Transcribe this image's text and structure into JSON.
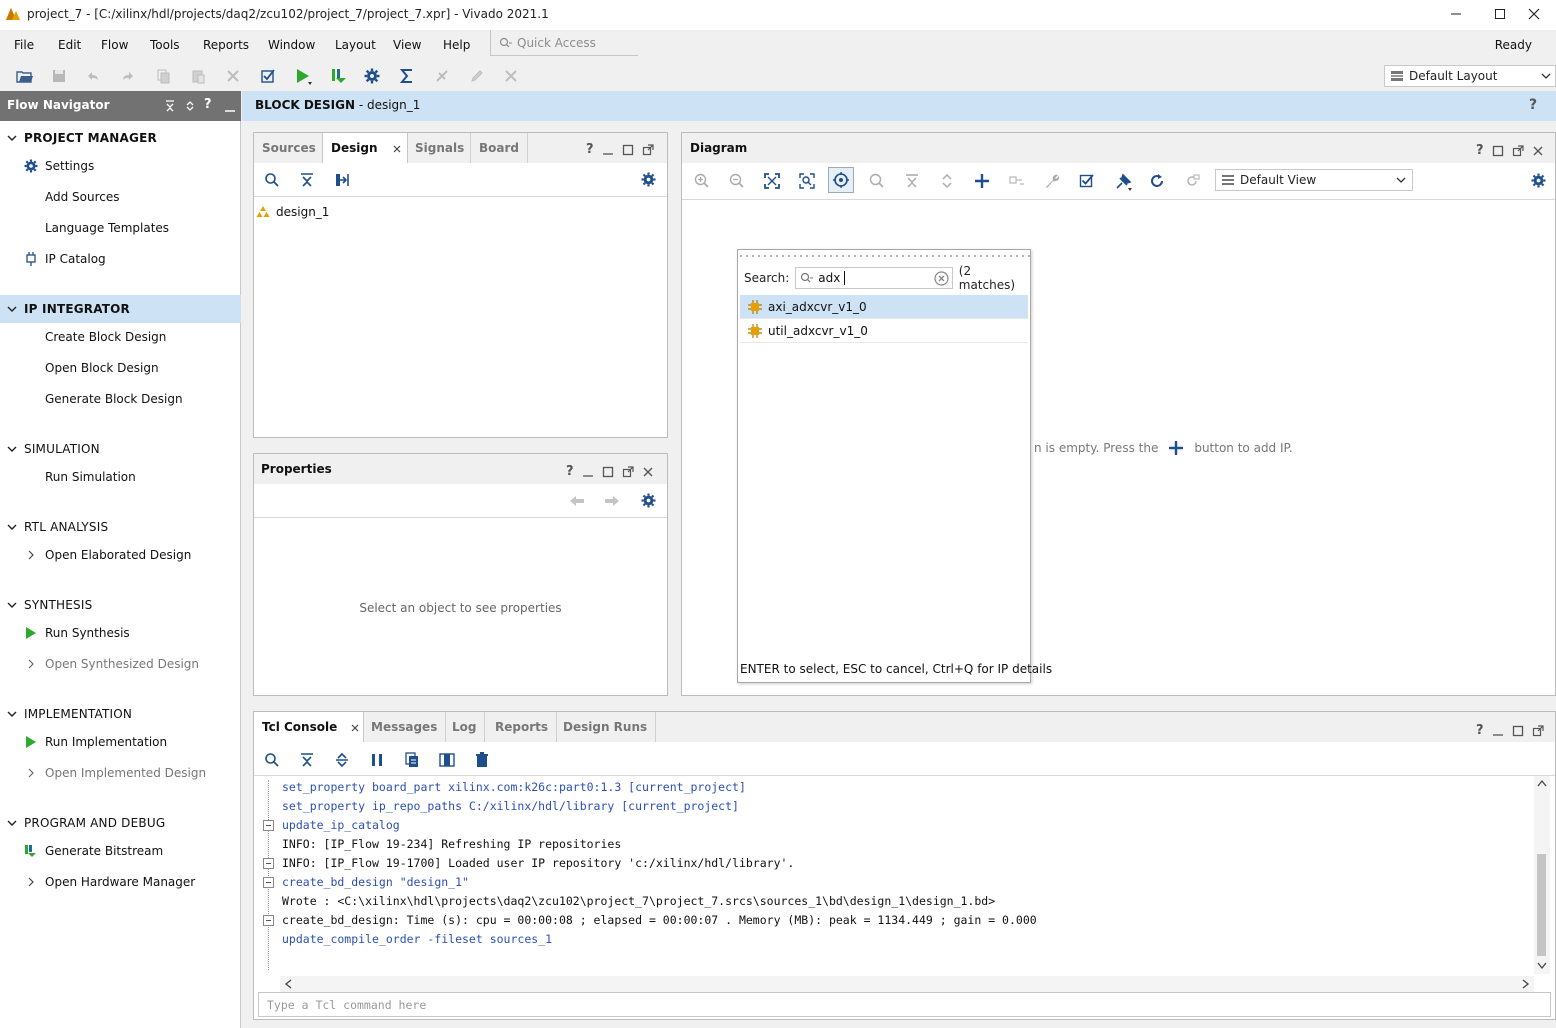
{
  "window": {
    "title": "project_7 - [C:/xilinx/hdl/projects/daq2/zcu102/project_7/project_7.xpr] - Vivado 2021.1"
  },
  "menu": [
    "File",
    "Edit",
    "Flow",
    "Tools",
    "Reports",
    "Window",
    "Layout",
    "View",
    "Help"
  ],
  "quick_access": {
    "placeholder": "Quick Access"
  },
  "status": "Ready",
  "layout_selector": "Default Layout",
  "flow_navigator": {
    "title": "Flow Navigator",
    "sections": [
      {
        "label": "PROJECT MANAGER",
        "items": [
          "Settings",
          "Add Sources",
          "Language Templates",
          "IP Catalog"
        ]
      },
      {
        "label": "IP INTEGRATOR",
        "items": [
          "Create Block Design",
          "Open Block Design",
          "Generate Block Design"
        ]
      },
      {
        "label": "SIMULATION",
        "items": [
          "Run Simulation"
        ]
      },
      {
        "label": "RTL ANALYSIS",
        "items": [
          "Open Elaborated Design"
        ]
      },
      {
        "label": "SYNTHESIS",
        "items": [
          "Run Synthesis",
          "Open Synthesized Design"
        ]
      },
      {
        "label": "IMPLEMENTATION",
        "items": [
          "Run Implementation",
          "Open Implemented Design"
        ]
      },
      {
        "label": "PROGRAM AND DEBUG",
        "items": [
          "Generate Bitstream",
          "Open Hardware Manager"
        ]
      }
    ]
  },
  "block_design": {
    "prefix": "BLOCK DESIGN",
    "name": " - design_1"
  },
  "sources_panel": {
    "tabs": [
      "Sources",
      "Design",
      "Signals",
      "Board"
    ],
    "tree": [
      "design_1"
    ]
  },
  "properties_panel": {
    "title": "Properties",
    "empty_text": "Select an object to see properties"
  },
  "diagram": {
    "title": "Diagram",
    "view_selector": "Default View",
    "empty_text_a": "n is empty. Press the",
    "empty_text_b": "button to add IP."
  },
  "ip_search": {
    "label": "Search:",
    "query": "adx",
    "matches": "(2 matches)",
    "results": [
      "axi_adxcvr_v1_0",
      "util_adxcvr_v1_0"
    ],
    "hint": "ENTER to select, ESC to cancel, Ctrl+Q for IP details"
  },
  "console": {
    "tabs": [
      "Tcl Console",
      "Messages",
      "Log",
      "Reports",
      "Design Runs"
    ],
    "lines": [
      "set_property board_part xilinx.com:k26c:part0:1.3 [current_project]",
      "set_property  ip_repo_paths  C:/xilinx/hdl/library [current_project]",
      "update_ip_catalog",
      "INFO: [IP_Flow 19-234] Refreshing IP repositories",
      "INFO: [IP_Flow 19-1700] Loaded user IP repository 'c:/xilinx/hdl/library'.",
      "create_bd_design \"design_1\"",
      "Wrote  : <C:\\xilinx\\hdl\\projects\\daq2\\zcu102\\project_7\\project_7.srcs\\sources_1\\bd\\design_1\\design_1.bd>",
      "create_bd_design: Time (s): cpu = 00:00:08 ; elapsed = 00:00:07 . Memory (MB): peak = 1134.449 ; gain = 0.000",
      "update_compile_order -fileset sources_1"
    ],
    "input_placeholder": "Type a Tcl command here"
  }
}
